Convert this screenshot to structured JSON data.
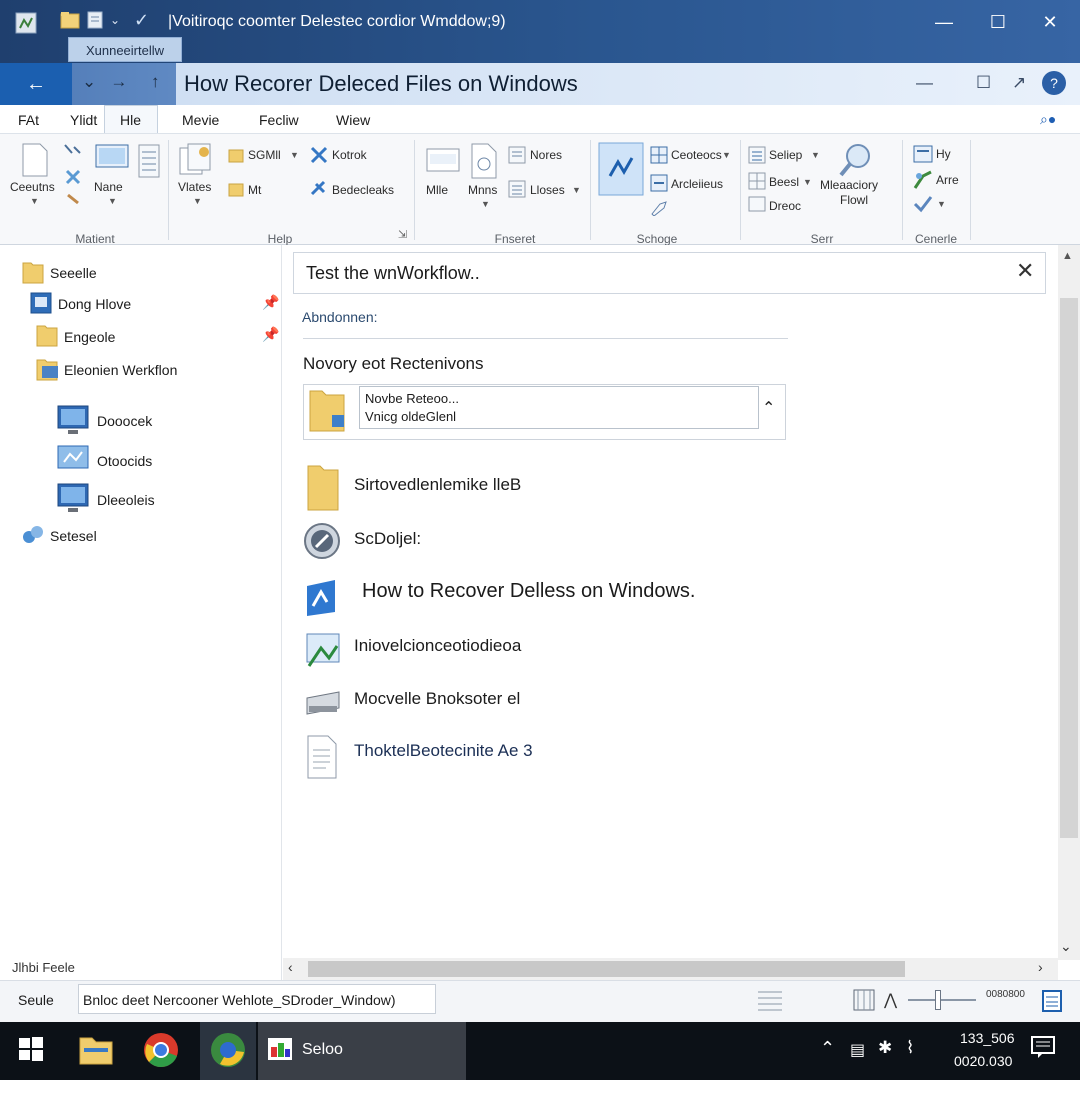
{
  "window": {
    "title": "|Voitiroqc coomter Delestec cordior Wmddow;9)",
    "tooltip": "Xunneeirtellw"
  },
  "nav": {
    "back_glyph": "←",
    "page_title": "How Recorer Deleced Files on Windows"
  },
  "menu": {
    "items": [
      "FAt",
      "Ylidt",
      "Hle",
      "Mevie",
      "Fecliw",
      "Wiew"
    ]
  },
  "ribbon": {
    "groups": {
      "g1": {
        "label": "Matient",
        "buttons": [
          "Ceeutns",
          "Nane"
        ]
      },
      "g2": {
        "label": "Help",
        "buttons": [
          "Vlates",
          "SGMll",
          "Mt",
          "Kotrok",
          "Bedecleaks"
        ]
      },
      "g3": {
        "label": "Fnseret",
        "buttons": [
          "Mlle",
          "Mnns",
          "Nores",
          "Lloses"
        ]
      },
      "g4": {
        "label": "Schoge",
        "buttons": [
          "Ceoteocs",
          "Arcleiieus"
        ]
      },
      "g5": {
        "label": "Serr",
        "buttons": [
          "Seliep",
          "Beesl",
          "Dreoc",
          "Mleaaciory",
          "Flowl"
        ]
      },
      "g6": {
        "label": "Cenerle",
        "buttons": [
          "Hy",
          "Arre"
        ]
      }
    }
  },
  "sidebar": {
    "items": [
      {
        "label": "Seeelle"
      },
      {
        "label": "Dong Hlove"
      },
      {
        "label": "Engeole"
      },
      {
        "label": "Eleonien Werkflon"
      },
      {
        "label": "Dooocek"
      },
      {
        "label": "Otoocids"
      },
      {
        "label": "Dleeoleis"
      },
      {
        "label": "Setesel"
      }
    ],
    "footer_label": "Jlhbi Feele"
  },
  "dialog": {
    "title": "Test the wnWorkflow.."
  },
  "main": {
    "section_label": "Abndonnen:",
    "heading": "Novory eot Rectenivons",
    "dropdown": {
      "line1": "Novbe Reteoo...",
      "line2": "Vnicg oldeGlenl"
    },
    "files": [
      {
        "label": "Sirtovedlenlemike lleB"
      },
      {
        "label": "ScDoljel:"
      },
      {
        "label": "How to Recover Delless on Windows."
      },
      {
        "label": "Iniovelcionceotiodieoa"
      },
      {
        "label": "Mocvelle Bnoksoter el"
      },
      {
        "label": "ThoktelBeotecinite Ae 3"
      }
    ]
  },
  "status": {
    "label": "Seule",
    "path": "Bnloc deet Nercooner Wehlote_SDroder_Window)",
    "zoom": "0080800"
  },
  "taskbar": {
    "app_label": "Seloo",
    "time": "133_506",
    "date": "0020.030"
  },
  "colors": {
    "titlebar": "#2a568f",
    "back_button": "#1b5fb0",
    "taskbar": "#0c1117",
    "folder": "#e9c15a"
  }
}
